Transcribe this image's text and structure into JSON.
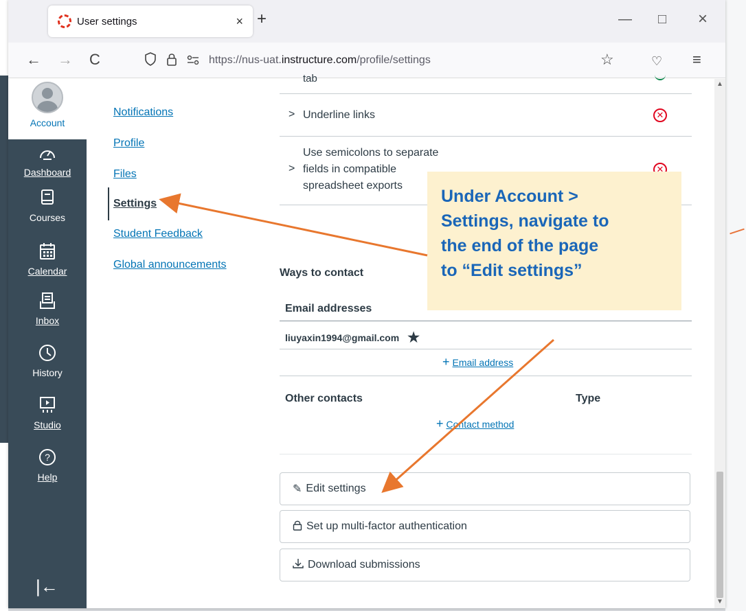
{
  "browser": {
    "tab_title": "User settings",
    "tab_close": "×",
    "new_tab": "+",
    "url_prefix": "https://nus-uat.",
    "url_domain": "instructure.com",
    "url_path": "/profile/settings",
    "back": "←",
    "forward": "→",
    "reload": "C",
    "minimize": "—",
    "maximize": "□",
    "close": "×",
    "menu": "≡",
    "pocket": "♡",
    "bookmark": "☆"
  },
  "global_nav": {
    "account": "Account",
    "items": [
      {
        "label": "Dashboard",
        "icon": "dashboard-icon",
        "glyph": "◠"
      },
      {
        "label": "Courses",
        "icon": "courses-icon",
        "glyph": "▤"
      },
      {
        "label": "Calendar",
        "icon": "calendar-icon",
        "glyph": "▦"
      },
      {
        "label": "Inbox",
        "icon": "inbox-icon",
        "glyph": "⊟"
      },
      {
        "label": "History",
        "icon": "history-icon",
        "glyph": "◷"
      },
      {
        "label": "Studio",
        "icon": "studio-icon",
        "glyph": "▭"
      },
      {
        "label": "Help",
        "icon": "help-icon",
        "glyph": "?"
      }
    ],
    "collapse": "|←"
  },
  "account_nav": {
    "items": [
      "Notifications",
      "Profile",
      "Files",
      "Settings",
      "Student Feedback",
      "Global announcements"
    ],
    "active": "Settings"
  },
  "features": {
    "partial_row": "tab",
    "underline_links": "Underline links",
    "semicolons": [
      "Use semicolons to separate",
      "fields in compatible",
      "spreadsheet exports"
    ]
  },
  "contact": {
    "heading": "Ways to contact",
    "email_heading": "Email addresses",
    "email": "liuyaxin1994@gmail.com",
    "add_email": "Email address",
    "other_heading": "Other contacts",
    "type_heading": "Type",
    "add_contact": "Contact method"
  },
  "actions": {
    "edit": "Edit settings",
    "mfa": "Set up multi-factor authentication",
    "download": "Download submissions"
  },
  "annotation": {
    "text": "Under Account >\nSettings, navigate to\nthe end of the page\nto “Edit settings”"
  },
  "colors": {
    "accent": "#0374b5",
    "nav_bg": "#394b58",
    "annotation_bg": "#fdf1cf",
    "annotation_text": "#1a66b8",
    "arrow": "#e8772e",
    "error": "#e0061f"
  }
}
